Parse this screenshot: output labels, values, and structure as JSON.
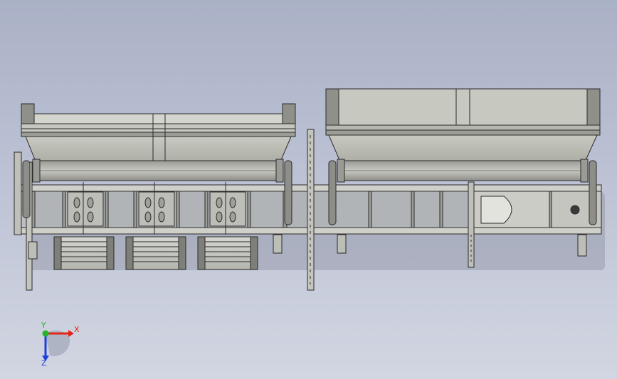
{
  "triad": {
    "x_label": "X",
    "y_label": "Y",
    "z_label": "Z",
    "x_color": "#e0261c",
    "y_color": "#26b52a",
    "z_color": "#1f3fd8"
  },
  "colors": {
    "background_top": "#aab1c6",
    "background_bottom": "#d2d6e2",
    "body_fill": "#c9cac2",
    "edge": "#2b2b2b",
    "shadow": "#7d8192"
  }
}
